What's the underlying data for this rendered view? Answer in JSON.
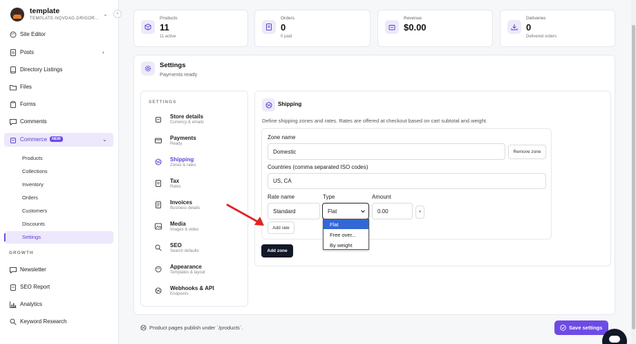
{
  "workspace": {
    "name": "template",
    "subtitle": "TEMPLATE-NQVDAG.GRIGOR..."
  },
  "sidebar": {
    "items": [
      {
        "label": "Site Editor"
      },
      {
        "label": "Posts"
      },
      {
        "label": "Directory Listings"
      },
      {
        "label": "Files"
      },
      {
        "label": "Forms"
      },
      {
        "label": "Comments"
      },
      {
        "label": "Commerce",
        "badge": "NEW"
      }
    ],
    "commerce_sub": [
      "Products",
      "Collections",
      "Inventory",
      "Orders",
      "Customers",
      "Discounts",
      "Settings"
    ],
    "growth_heading": "GROWTH",
    "growth_items": [
      "Newsletter",
      "SEO Report",
      "Analytics",
      "Keyword Research"
    ]
  },
  "stats": [
    {
      "label": "Products",
      "value": "11",
      "sub": "11 active"
    },
    {
      "label": "Orders",
      "value": "0",
      "sub": "0 paid"
    },
    {
      "label": "Revenue",
      "value": "$0.00",
      "sub": ""
    },
    {
      "label": "Deliveries",
      "value": "0",
      "sub": "Delivered orders"
    }
  ],
  "settings": {
    "title": "Settings",
    "subtitle": "Payments ready",
    "nav_heading": "SETTINGS"
  },
  "settings_nav": [
    {
      "title": "Store details",
      "sub": "Currency & emails"
    },
    {
      "title": "Payments",
      "sub": "Ready"
    },
    {
      "title": "Shipping",
      "sub": "Zones & rates"
    },
    {
      "title": "Tax",
      "sub": "Rates"
    },
    {
      "title": "Invoices",
      "sub": "Business details"
    },
    {
      "title": "Media",
      "sub": "Images & video"
    },
    {
      "title": "SEO",
      "sub": "Search defaults"
    },
    {
      "title": "Appearance",
      "sub": "Templates & layout"
    },
    {
      "title": "Webhooks & API",
      "sub": "Endpoints"
    }
  ],
  "shipping": {
    "title": "Shipping",
    "description": "Define shipping zones and rates. Rates are offered at checkout based on cart subtotal and weight.",
    "zone_name_label": "Zone name",
    "zone_name_value": "Domestic",
    "remove_zone": "Remove zone",
    "countries_label": "Countries (comma separated ISO codes)",
    "countries_value": "US, CA",
    "rate_name_label": "Rate name",
    "type_label": "Type",
    "amount_label": "Amount",
    "rate_name_value": "Standard",
    "type_value": "Flat",
    "amount_value": "0.00",
    "remove_rate": "×",
    "add_rate": "Add rate",
    "add_zone": "Add zone",
    "type_options": [
      "Flat",
      "Free over...",
      "By weight"
    ]
  },
  "footer_note": "Product pages publish under `/products`.",
  "save_button": "Save settings",
  "colors": {
    "accent": "#6d4be6",
    "accent_light": "#ede8fb",
    "dark_button": "#111827",
    "arrow": "#e02424",
    "dropdown_selected": "#3367d6"
  }
}
